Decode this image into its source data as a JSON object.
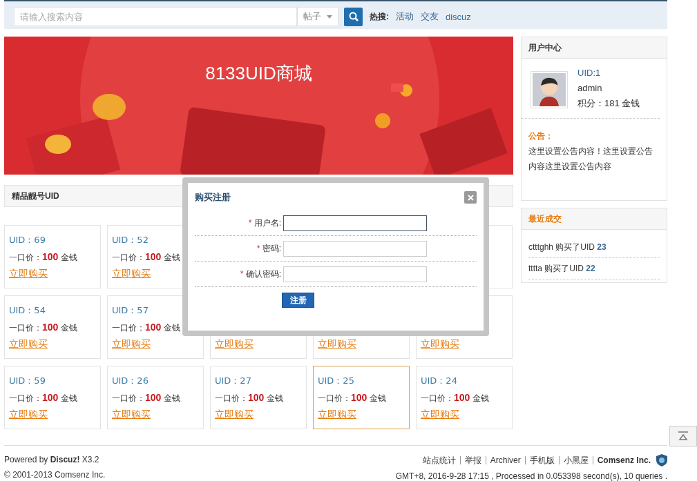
{
  "search": {
    "placeholder": "请输入搜索内容",
    "scope": "帖子",
    "hot_label": "热搜:",
    "hot_links": [
      "活动",
      "交友",
      "discuz"
    ]
  },
  "banner": {
    "title": "8133UID商城"
  },
  "section": {
    "title": "精品靓号UID"
  },
  "cards": [
    {
      "uid": "UID：69",
      "price_label": "一口价：",
      "price": "100",
      "unit": "金钱",
      "buy": "立即购买",
      "selected": false
    },
    {
      "uid": "UID：52",
      "price_label": "一口价：",
      "price": "100",
      "unit": "金钱",
      "buy": "立即购买",
      "selected": false
    },
    {
      "selected": false
    },
    {
      "uid": "UID：54",
      "price_label": "一口价：",
      "price": "100",
      "unit": "金钱",
      "buy": "立即购买",
      "selected": false
    },
    {
      "uid": "UID：57",
      "price_label": "一口价：",
      "price": "100",
      "unit": "金钱",
      "buy": "立即购买",
      "selected": false
    },
    {
      "buy": "立即购买",
      "selected": false
    },
    {
      "buy": "立即购买",
      "selected": false
    },
    {
      "buy": "立即购买",
      "selected": false
    },
    {
      "uid": "UID：59",
      "price_label": "一口价：",
      "price": "100",
      "unit": "金钱",
      "buy": "立即购买",
      "selected": false
    },
    {
      "uid": "UID：26",
      "price_label": "一口价：",
      "price": "100",
      "unit": "金钱",
      "buy": "立即购买",
      "selected": false
    },
    {
      "uid": "UID：27",
      "price_label": "一口价：",
      "price": "100",
      "unit": "金钱",
      "buy": "立即购买",
      "selected": false
    },
    {
      "uid": "UID：25",
      "price_label": "一口价：",
      "price": "100",
      "unit": "金钱",
      "buy": "立即购买",
      "selected": true
    },
    {
      "uid": "UID：24",
      "price_label": "一口价：",
      "price": "100",
      "unit": "金钱",
      "buy": "立即购买",
      "selected": false
    }
  ],
  "user_center": {
    "title": "用户中心",
    "uid": "UID:1",
    "name": "admin",
    "points": "积分：181 金钱",
    "notice_label": "公告：",
    "notice": "这里设置公告内容！这里设置公告内容这里设置公告内容"
  },
  "recent": {
    "title": "最近成交",
    "items": [
      "ctttghh 购买了UID **23**",
      "tttta 购买了UID **22**"
    ]
  },
  "modal": {
    "title": "购买注册",
    "fields": [
      {
        "mark": "*",
        "label": "用户名:",
        "required": true,
        "focused": true
      },
      {
        "mark": "*",
        "label": "密码:",
        "required": true,
        "focused": false
      },
      {
        "mark": "*",
        "label": "确认密码:",
        "required": true,
        "focused": false
      }
    ],
    "submit": "注册"
  },
  "footer": {
    "powered": "Powered by **Discuz!** X3.2",
    "copyright": "© 2001-2013 Comsenz Inc.",
    "links": [
      {
        "text": "站点统计",
        "bold": false
      },
      {
        "text": "举报",
        "bold": false
      },
      {
        "text": "Archiver",
        "bold": false
      },
      {
        "text": "手机版",
        "bold": false
      },
      {
        "text": "小黑屋",
        "bold": false
      },
      {
        "text": "Comsenz Inc.",
        "bold": true
      }
    ],
    "stats": "GMT+8, 2016-9-28 17:15 , Processed in 0.053398 second(s), 10 queries ."
  }
}
